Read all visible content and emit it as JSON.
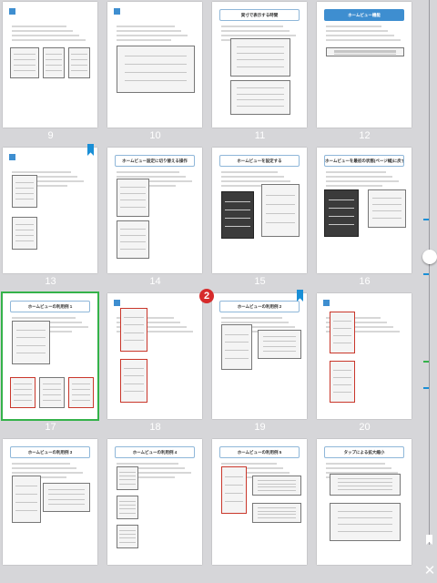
{
  "pages": [
    {
      "num": "9",
      "title": "",
      "bookmark": false
    },
    {
      "num": "10",
      "title": "",
      "bookmark": false
    },
    {
      "num": "11",
      "title": "実寸で表示する時間",
      "bookmark": false
    },
    {
      "num": "12",
      "title": "ホームビュー機能",
      "bookmark": false
    },
    {
      "num": "13",
      "title": "",
      "bookmark": true
    },
    {
      "num": "14",
      "title": "ホームビュー設定に切り替える操作",
      "bookmark": false
    },
    {
      "num": "15",
      "title": "ホームビューを設定する",
      "bookmark": false
    },
    {
      "num": "16",
      "title": "ホームビューを最初の状態(ページ幅)に戻す",
      "bookmark": false
    },
    {
      "num": "17",
      "title": "ホームビューの利用例 1",
      "bookmark": false,
      "selected": true
    },
    {
      "num": "18",
      "title": "",
      "bookmark": false
    },
    {
      "num": "19",
      "title": "ホームビューの利用例 2",
      "bookmark": true
    },
    {
      "num": "20",
      "title": "",
      "bookmark": false
    },
    {
      "num": "",
      "title": "ホームビューの利用例 3",
      "bookmark": false
    },
    {
      "num": "",
      "title": "ホームビューの利用例 4",
      "bookmark": false
    },
    {
      "num": "",
      "title": "ホームビューの利用例 5",
      "bookmark": false
    },
    {
      "num": "",
      "title": "タップによる拡大縮小",
      "bookmark": false
    }
  ],
  "marker_label": "2",
  "close_label": "✕",
  "colors": {
    "accent": "#3e8ed0",
    "selected": "#34b24a",
    "marker": "#d62b2b",
    "bookmark": "#1a8fd6"
  }
}
